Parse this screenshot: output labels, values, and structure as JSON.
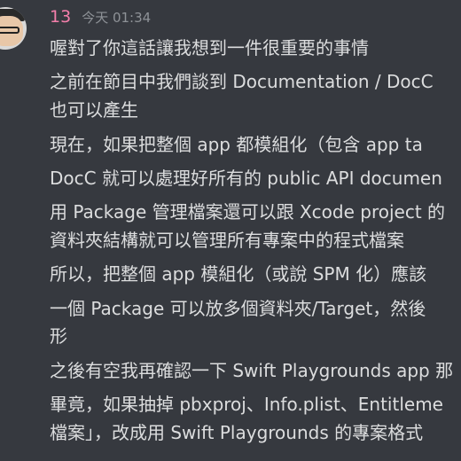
{
  "author": {
    "username": "13",
    "timestamp": "今天 01:34"
  },
  "lines": [
    "喔對了你這話讓我想到一件很重要的事情",
    "之前在節目中我們談到 Documentation / DocC",
    "也可以產生",
    "現在，如果把整個 app 都模組化（包含 app ta",
    "DocC 就可以處理好所有的 public API documen",
    "用 Package 管理檔案還可以跟 Xcode project 的",
    "資料夾結構就可以管理所有專案中的程式檔案",
    "所以，把整個 app 模組化（或說 SPM 化）應該",
    "一個 Package 可以放多個資料夾/Target，然後",
    "形",
    "之後有空我再確認一下 Swift Playgrounds app 那",
    "畢竟，如果抽掉 pbxproj、Info.plist、Entitleme",
    "檔案」，改成用 Swift Playgrounds 的專案格式"
  ]
}
